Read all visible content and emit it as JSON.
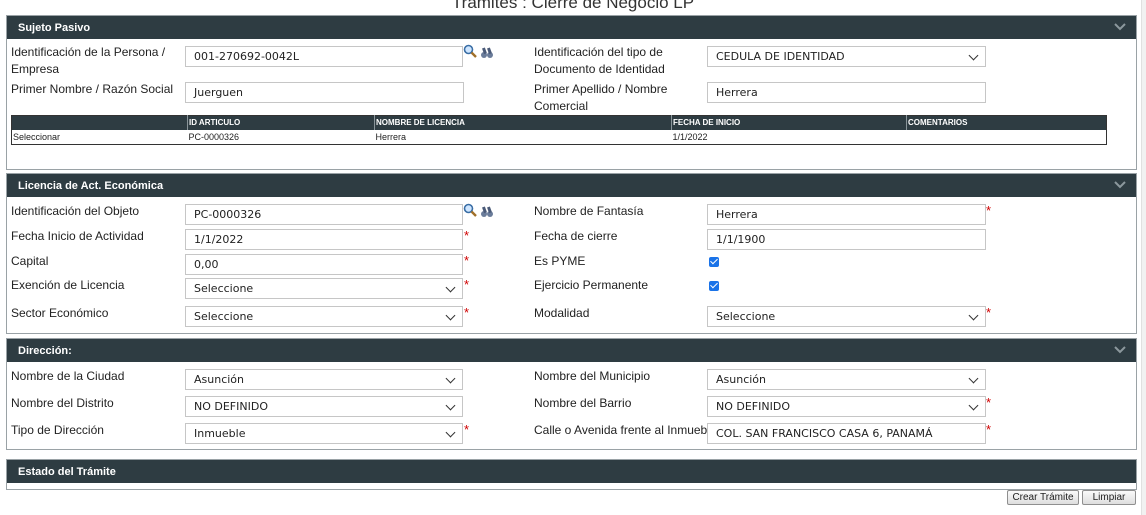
{
  "page": {
    "title": "Tramites : Cierre de Negocio LP"
  },
  "sujeto": {
    "header": "Sujeto Pasivo",
    "id_label": "Identificación de la Persona / Empresa",
    "id_value": "001-270692-0042L",
    "tipo_doc_label": "Identificación del tipo de Documento de Identidad",
    "tipo_doc_value": "CEDULA DE IDENTIDAD",
    "nombre_label": "Primer Nombre / Razón Social",
    "nombre_value": "Juerguen",
    "apellido_label": "Primer Apellido / Nombre Comercial",
    "apellido_value": "Herrera",
    "grid": {
      "columns": [
        "",
        "ID ARTICULO",
        "NOMBRE DE LICENCIA",
        "FECHA DE INICIO",
        "COMENTARIOS"
      ],
      "rows": [
        {
          "action": "Seleccionar",
          "id": "PC-0000326",
          "nombre": "Herrera",
          "fecha": "1/1/2022",
          "comentarios": ""
        }
      ]
    }
  },
  "licencia": {
    "header": "Licencia de Act. Económica",
    "objeto_label": "Identificación del Objeto",
    "objeto_value": "PC-0000326",
    "fantasia_label": "Nombre de Fantasía",
    "fantasia_value": "Herrera",
    "fecha_inicio_label": "Fecha Inicio de Actividad",
    "fecha_inicio_value": "1/1/2022",
    "fecha_cierre_label": "Fecha de cierre",
    "fecha_cierre_value": "1/1/1900",
    "capital_label": "Capital",
    "capital_value": "0,00",
    "pyme_label": "Es PYME",
    "pyme_checked": true,
    "exencion_label": "Exención de Licencia",
    "exencion_value": "Seleccione",
    "ejercicio_label": "Ejercicio Permanente",
    "ejercicio_checked": true,
    "sector_label": "Sector Económico",
    "sector_value": "Seleccione",
    "modalidad_label": "Modalidad",
    "modalidad_value": "Seleccione"
  },
  "direccion": {
    "header": "Dirección:",
    "ciudad_label": "Nombre de la Ciudad",
    "ciudad_value": "Asunción",
    "municipio_label": "Nombre del Municipio",
    "municipio_value": "Asunción",
    "distrito_label": "Nombre del Distrito",
    "distrito_value": "NO DEFINIDO",
    "barrio_label": "Nombre del Barrio",
    "barrio_value": "NO DEFINIDO",
    "tipo_label": "Tipo de Dirección",
    "tipo_value": "Inmueble",
    "calle_label": "Calle o Avenida frente al Inmueble",
    "calle_value": "COL. SAN FRANCISCO CASA 6, PANAMÁ"
  },
  "estado": {
    "header": "Estado del Trámite"
  },
  "actions": {
    "crear_label": "Crear Trámite",
    "limpiar_label": "Limpiar"
  },
  "colors": {
    "header_bg": "#2e3c42",
    "required": "#d00000",
    "checkbox": "#1a73e8"
  },
  "icons": [
    "search-icon",
    "binoculars-icon",
    "chevron-down-icon"
  ]
}
